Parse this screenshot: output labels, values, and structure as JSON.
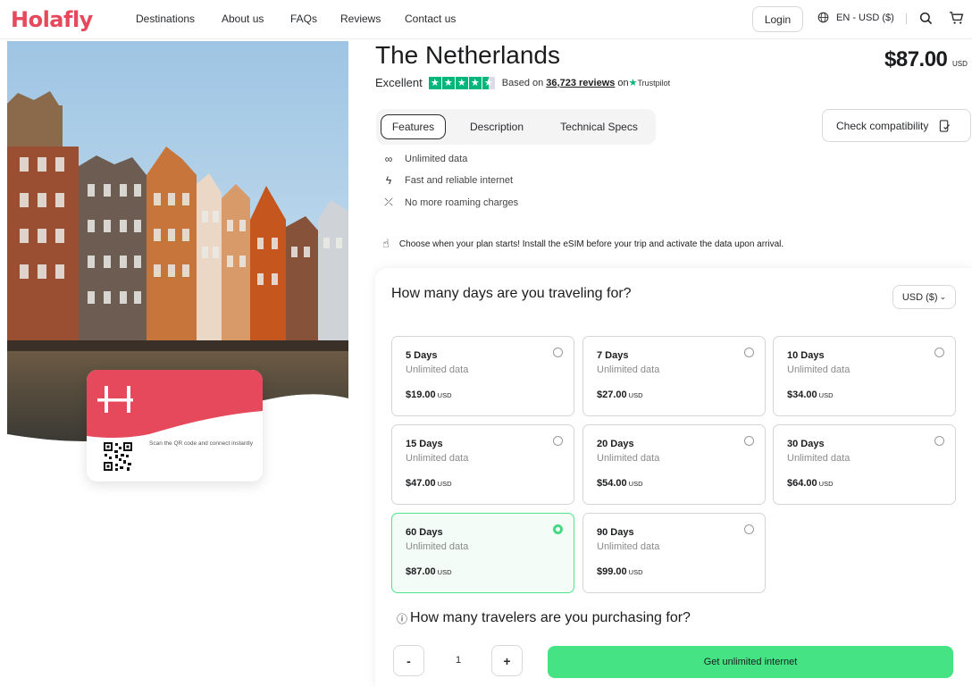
{
  "header": {
    "logo": "Holafly",
    "nav": [
      "Destinations",
      "About us",
      "FAQs",
      "Reviews",
      "Contact us"
    ],
    "login_label": "Login",
    "language_currency": "EN - USD ($)"
  },
  "product": {
    "title": "The Netherlands",
    "price": "$87.00",
    "price_currency": "USD",
    "rating_label": "Excellent",
    "rating_stars": 4.5,
    "based_on_prefix": "Based on",
    "reviews_count": "36,723 reviews",
    "on_label": "on",
    "trustpilot": "Trustpilot"
  },
  "esim_card": {
    "caption": "Scan the QR code and connect instantly"
  },
  "tabs": [
    "Features",
    "Description",
    "Technical Specs"
  ],
  "check_compatibility": "Check compatibility",
  "features": [
    {
      "icon": "infinity-icon",
      "label": "Unlimited data"
    },
    {
      "icon": "lightning-icon",
      "label": "Fast and reliable internet"
    },
    {
      "icon": "no-roaming-icon",
      "label": "No more roaming charges"
    }
  ],
  "notice": "Choose when your plan starts! Install the eSIM before your trip and activate the data upon arrival.",
  "plan_panel": {
    "days_question": "How many days are you traveling for?",
    "currency_select": "USD ($)",
    "plans": [
      {
        "days": "5 Days",
        "data": "Unlimited data",
        "price": "$19.00",
        "currency": "USD",
        "selected": false
      },
      {
        "days": "7 Days",
        "data": "Unlimited data",
        "price": "$27.00",
        "currency": "USD",
        "selected": false
      },
      {
        "days": "10 Days",
        "data": "Unlimited data",
        "price": "$34.00",
        "currency": "USD",
        "selected": false
      },
      {
        "days": "15 Days",
        "data": "Unlimited data",
        "price": "$47.00",
        "currency": "USD",
        "selected": false
      },
      {
        "days": "20 Days",
        "data": "Unlimited data",
        "price": "$54.00",
        "currency": "USD",
        "selected": false
      },
      {
        "days": "30 Days",
        "data": "Unlimited data",
        "price": "$64.00",
        "currency": "USD",
        "selected": false
      },
      {
        "days": "60 Days",
        "data": "Unlimited data",
        "price": "$87.00",
        "currency": "USD",
        "selected": true
      },
      {
        "days": "90 Days",
        "data": "Unlimited data",
        "price": "$99.00",
        "currency": "USD",
        "selected": false
      }
    ],
    "travelers_question": "How many travelers are you purchasing for?",
    "minus_label": "-",
    "plus_label": "+",
    "quantity": "1",
    "cta_label": "Get unlimited internet"
  },
  "colors": {
    "brand": "#e6485c",
    "accent_green": "#45e383",
    "trustpilot_green": "#00b67a"
  }
}
